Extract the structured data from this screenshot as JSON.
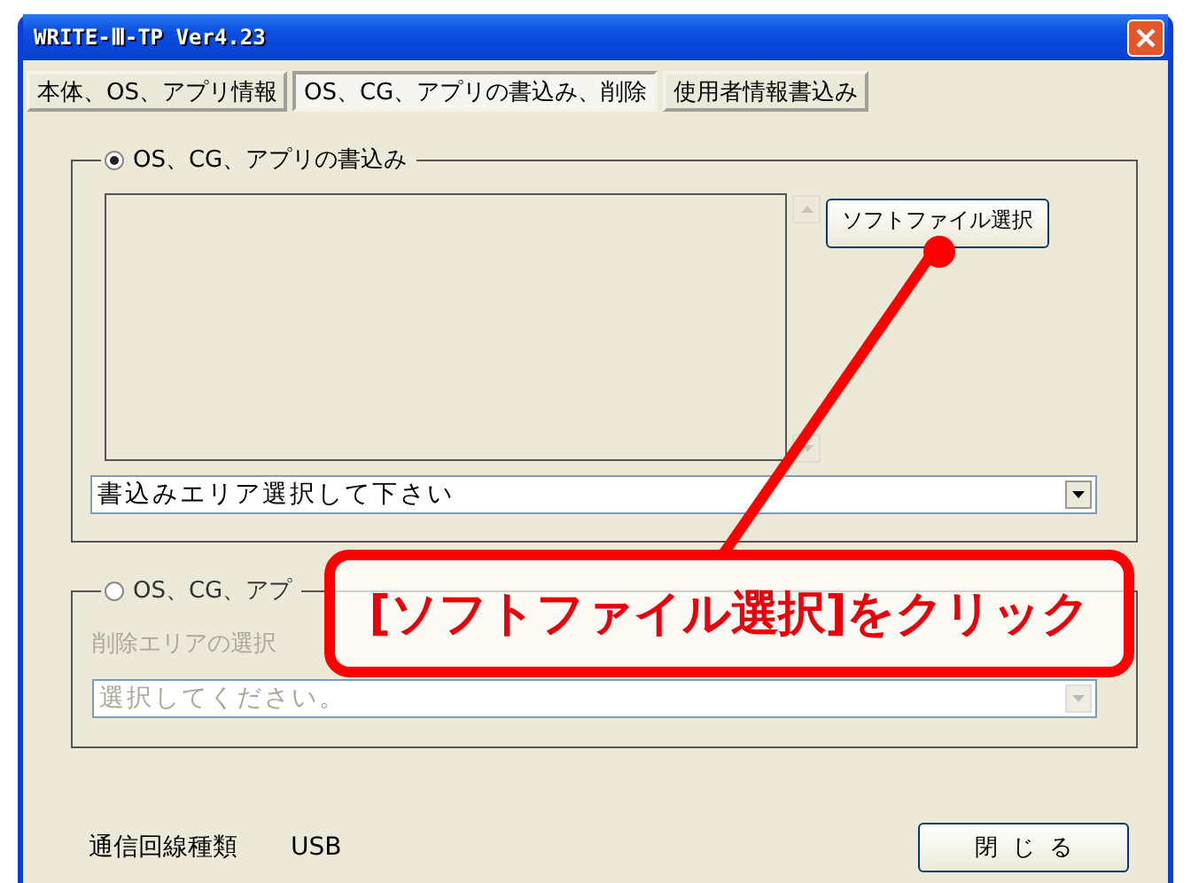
{
  "window": {
    "title": "WRITE-Ⅲ-TP Ver4.23"
  },
  "tabs": [
    {
      "label": "本体、OS、アプリ情報",
      "selected": false
    },
    {
      "label": "OS、CG、アプリの書込み、削除",
      "selected": true
    },
    {
      "label": "使用者情報書込み",
      "selected": false
    }
  ],
  "write_group": {
    "label": "OS、CG、アプリの書込み",
    "selected": true,
    "button": "ソフトファイル選択",
    "area_combo": {
      "value": "書込みエリア選択して下さい"
    }
  },
  "delete_group": {
    "label": "OS、CG、アプ",
    "selected": false,
    "disabled": true,
    "area_label": "削除エリアの選択",
    "area_combo": {
      "value": "選択してください。"
    }
  },
  "connection": {
    "label": "通信回線種類",
    "value": "USB"
  },
  "close_button": "閉じる",
  "callout": {
    "text": "[ソフトファイル選択]をクリック"
  }
}
